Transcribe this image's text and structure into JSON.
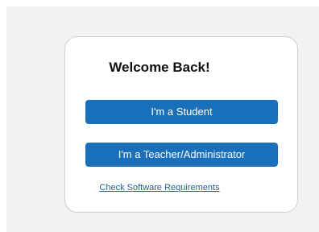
{
  "login": {
    "title": "Welcome Back!",
    "student_button_label": "I'm a Student",
    "teacher_button_label": "I'm a Teacher/Administrator",
    "requirements_link_label": "Check Software Requirements"
  },
  "colors": {
    "button_background": "#1a6fba",
    "link": "#1f5f9c",
    "page_background": "#f2f2f4"
  }
}
